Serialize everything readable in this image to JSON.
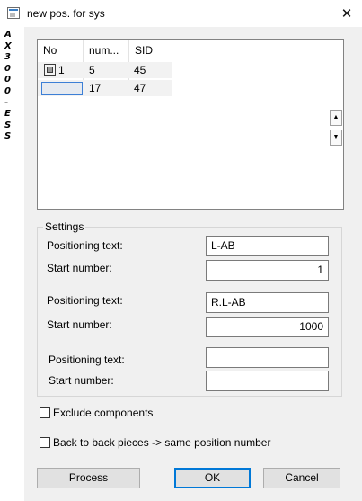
{
  "window": {
    "title": "new pos. for sys",
    "close_glyph": "✕"
  },
  "side_label": "AX3000 - ESS",
  "list": {
    "headers": [
      "No",
      "num...",
      "SID"
    ],
    "rows": [
      {
        "no": "1",
        "num": "5",
        "sid": "45",
        "icon": "component-icon"
      },
      {
        "no": "",
        "num": "17",
        "sid": "47",
        "icon": ""
      }
    ]
  },
  "spin": {
    "up": "▲",
    "down": "▼"
  },
  "settings": {
    "legend": "Settings",
    "groups": [
      {
        "pos_label": "Positioning text:",
        "pos_value": "L-AB",
        "start_label": "Start number:",
        "start_value": "1"
      },
      {
        "pos_label": "Positioning text:",
        "pos_value": "R.L-AB",
        "start_label": "Start number:",
        "start_value": "1000"
      },
      {
        "pos_label": "Positioning text:",
        "pos_value": "",
        "start_label": "Start number:",
        "start_value": ""
      }
    ]
  },
  "options": {
    "exclude_label": "Exclude components",
    "exclude_checked": false,
    "back_to_back_label": "Back to back pieces -> same position number",
    "back_to_back_checked": false
  },
  "buttons": {
    "process": "Process",
    "ok": "OK",
    "cancel": "Cancel"
  }
}
